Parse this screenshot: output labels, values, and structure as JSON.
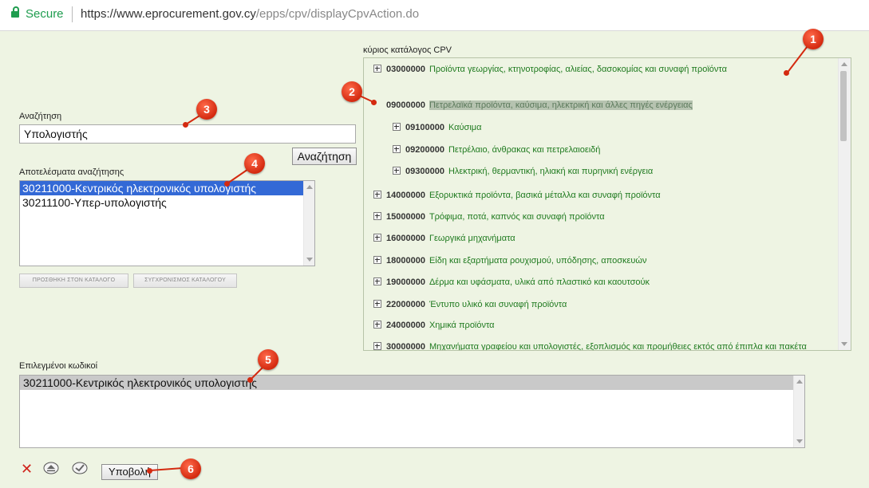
{
  "browser": {
    "secure_label": "Secure",
    "url_main": "https://www.eprocurement.gov.cy",
    "url_path": "/epps/cpv/displayCpvAction.do"
  },
  "search": {
    "label": "Αναζήτηση",
    "value": "Υπολογιστής",
    "button_label": "Αναζήτηση"
  },
  "results": {
    "label": "Αποτελέσματα αναζήτησης",
    "items": [
      "30211000-Κεντρικός ηλεκτρονικός υπολογιστής",
      "30211100-Υπερ-υπολογιστής"
    ],
    "add_button": "ΠΡΟΣΘΗΚΗ ΣΤΟΝ ΚΑΤΑΛΟΓΟ",
    "sync_button": "ΣΥΓΧΡΟΝΙΣΜΟΣ ΚΑΤΑΛΟΓΟΥ"
  },
  "cpv": {
    "label": "κύριος κατάλογος CPV",
    "rows": [
      {
        "code": "03000000",
        "desc": "Προϊόντα γεωργίας, κτηνοτροφίας, αλιείας, δασοκομίας και συναφή προϊόντα"
      },
      {
        "code": "09000000",
        "desc": "Πετρελαϊκά προϊόντα, καύσιμα, ηλεκτρική και άλλες πηγές ενέργειας"
      },
      {
        "code": "09100000",
        "desc": "Καύσιμα"
      },
      {
        "code": "09200000",
        "desc": "Πετρέλαιο, άνθρακας και πετρελαιοειδή"
      },
      {
        "code": "09300000",
        "desc": "Ηλεκτρική, θερμαντική, ηλιακή και πυρηνική ενέργεια"
      },
      {
        "code": "14000000",
        "desc": "Εξορυκτικά προϊόντα, βασικά μέταλλα και συναφή προϊόντα"
      },
      {
        "code": "15000000",
        "desc": "Τρόφιμα, ποτά, καπνός και συναφή προϊόντα"
      },
      {
        "code": "16000000",
        "desc": "Γεωργικά μηχανήματα"
      },
      {
        "code": "18000000",
        "desc": "Είδη και εξαρτήματα ρουχισμού, υπόδησης, αποσκευών"
      },
      {
        "code": "19000000",
        "desc": "Δέρμα και υφάσματα, υλικά από πλαστικό και καουτσούκ"
      },
      {
        "code": "22000000",
        "desc": "Έντυπο υλικό και συναφή προϊόντα"
      },
      {
        "code": "24000000",
        "desc": "Χημικά προϊόντα"
      },
      {
        "code": "30000000",
        "desc": "Μηχανήματα γραφείου και υπολογιστές, εξοπλισμός και προμήθειες εκτός από έπιπλα και πακέτα"
      }
    ]
  },
  "selected": {
    "label": "Επιλεγμένοι κωδικοί",
    "item": "30211000-Κεντρικός ηλεκτρονικός υπολογιστής"
  },
  "submit_label": "Υποβολή",
  "callouts": [
    "1",
    "2",
    "3",
    "4",
    "5",
    "6"
  ],
  "icons": {
    "secure": "lock-icon",
    "delete": "x-icon",
    "move": "eject-icon",
    "confirm": "check-icon"
  },
  "colors": {
    "page_bg": "#eef4e3",
    "secure_green": "#1f9d4f",
    "cpv_text": "#1f7a1f",
    "selection_blue": "#3369d6",
    "callout_red": "#d42a10"
  }
}
